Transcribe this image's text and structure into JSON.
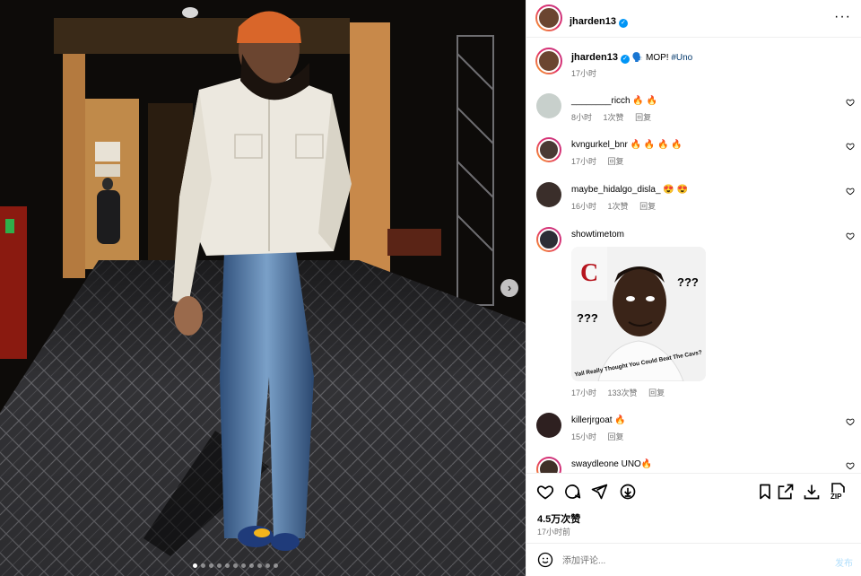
{
  "post": {
    "author": "jharden13",
    "caption_emoji": "🗣️",
    "caption_text": "MOP!",
    "caption_tag": "#Uno",
    "caption_time": "17小时",
    "more_icon": "more-horizontal-icon",
    "verified_icon": "verified-badge-icon"
  },
  "photo": {
    "next_icon": "chevron-right-icon",
    "next_glyph": "›",
    "carousel_count": 11,
    "carousel_active": 1
  },
  "comments": [
    {
      "user": "________ricch",
      "text": "🔥 🔥",
      "time": "8小时",
      "likes": "1次赞",
      "reply": "回复"
    },
    {
      "user": "kvngurkel_bnr",
      "text": "🔥 🔥 🔥 🔥",
      "time": "17小时",
      "likes": "",
      "reply": "回复"
    },
    {
      "user": "maybe_hidalgo_disla_",
      "text": "😍 😍",
      "time": "16小时",
      "likes": "1次赞",
      "reply": "回复"
    },
    {
      "user": "showtimetom",
      "text": "",
      "time": "17小时",
      "likes": "133次赞",
      "reply": "回复",
      "image": {
        "caption": "Yall Really Thought You Could Beat The Cavs?",
        "marks": "???"
      }
    },
    {
      "user": "killerjrgoat",
      "text": "🔥",
      "time": "15小时",
      "likes": "",
      "reply": "回复"
    },
    {
      "user": "swaydleone",
      "text": "UNO🔥",
      "time": "",
      "likes": "",
      "reply": ""
    }
  ],
  "actions": {
    "like_icon": "heart-icon",
    "comment_icon": "comment-icon",
    "share_icon": "send-icon",
    "download_icon": "download-circle-icon",
    "save_icon": "bookmark-icon",
    "open_icon": "external-link-icon",
    "download2_icon": "download-icon",
    "zip_icon": "zip-icon",
    "zip_label": "ZIP",
    "likes_count": "4.5万次赞",
    "post_time": "17小时前"
  },
  "add_comment": {
    "placeholder": "添加评论...",
    "post_label": "发布",
    "emoji_icon": "smiley-icon"
  },
  "colors": {
    "accent": "#0095f6",
    "meta": "#737373",
    "hashtag": "#00376b",
    "post_disabled": "#b2dffc"
  }
}
